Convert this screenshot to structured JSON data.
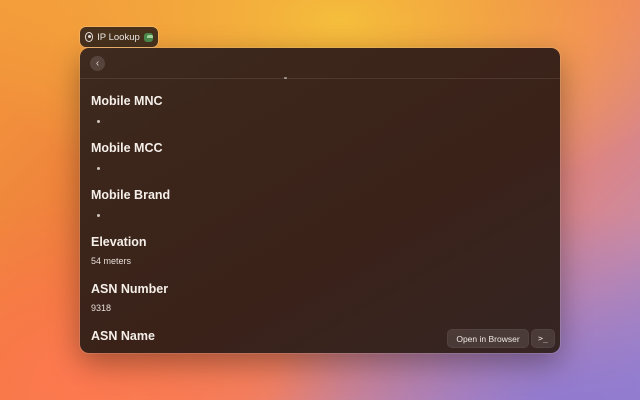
{
  "extension": {
    "title": "IP Lookup",
    "icon": "clock-icon",
    "badge_icon": "cloud-icon"
  },
  "topbar": {
    "back_icon": "chevron-left-icon",
    "back_glyph": "‹"
  },
  "details": [
    {
      "label": "Mobile MNC",
      "value": ""
    },
    {
      "label": "Mobile MCC",
      "value": ""
    },
    {
      "label": "Mobile Brand",
      "value": ""
    },
    {
      "label": "Elevation",
      "value": "54 meters"
    },
    {
      "label": "ASN Number",
      "value": "9318"
    },
    {
      "label": "ASN Name",
      "value": ""
    }
  ],
  "actions": {
    "open_browser_label": "Open in Browser",
    "terminal_glyph": ">_"
  },
  "colors": {
    "window_bg": "#3b241a",
    "pill_badge": "#4c8a4c"
  }
}
